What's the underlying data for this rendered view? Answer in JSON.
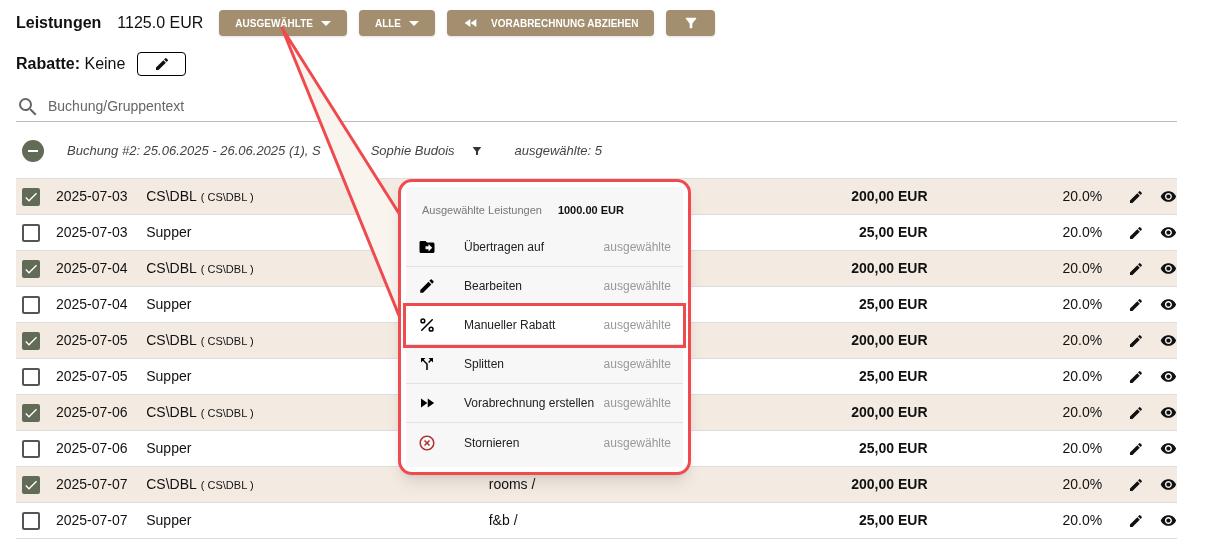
{
  "header": {
    "title": "Leistungen",
    "total": "1125.0 EUR"
  },
  "toolbar": [
    {
      "label": "AUSGEWÄHLTE",
      "kind": "dropdown"
    },
    {
      "label": "ALLE",
      "kind": "dropdown"
    },
    {
      "label": "VORABRECHNUNG ABZIEHEN",
      "kind": "rewind"
    },
    {
      "kind": "filter"
    }
  ],
  "discount": {
    "label": "Rabatte:",
    "value": "Keine"
  },
  "search": {
    "placeholder": "Buchung/Gruppentext"
  },
  "group": {
    "expanded": true,
    "title_start": "Buchung #2: 25.06.2025 - 26.06.2025 (1), S",
    "title_end": "Sophie Budois",
    "selected_count": "ausgewählte: 5"
  },
  "rows": [
    {
      "checked": true,
      "date": "2025-07-03",
      "name": "CS\\DBL",
      "code": "( CS\\DBL )",
      "amount": "200,00 EUR",
      "tax": "20.0%"
    },
    {
      "checked": false,
      "date": "2025-07-03",
      "name": "Supper",
      "amount": "25,00 EUR",
      "tax": "20.0%"
    },
    {
      "checked": true,
      "date": "2025-07-04",
      "name": "CS\\DBL",
      "code": "( CS\\DBL )",
      "amount": "200,00 EUR",
      "tax": "20.0%"
    },
    {
      "checked": false,
      "date": "2025-07-04",
      "name": "Supper",
      "amount": "25,00 EUR",
      "tax": "20.0%"
    },
    {
      "checked": true,
      "date": "2025-07-05",
      "name": "CS\\DBL",
      "code": "( CS\\DBL )",
      "amount": "200,00 EUR",
      "tax": "20.0%"
    },
    {
      "checked": false,
      "date": "2025-07-05",
      "name": "Supper",
      "amount": "25,00 EUR",
      "tax": "20.0%"
    },
    {
      "checked": true,
      "date": "2025-07-06",
      "name": "CS\\DBL",
      "code": "( CS\\DBL )",
      "amount": "200,00 EUR",
      "tax": "20.0%"
    },
    {
      "checked": false,
      "date": "2025-07-06",
      "name": "Supper",
      "amount": "25,00 EUR",
      "tax": "20.0%"
    },
    {
      "checked": true,
      "date": "2025-07-07",
      "name": "CS\\DBL",
      "code": "( CS\\DBL )",
      "column_3": "rooms /",
      "amount": "200,00 EUR",
      "tax": "20.0%"
    },
    {
      "checked": false,
      "date": "2025-07-07",
      "name": "Supper",
      "column_3": "f&b /",
      "amount": "25,00 EUR",
      "tax": "20.0%"
    }
  ],
  "menu": {
    "title": "Ausgewählte Leistungen",
    "total": "1000.00 EUR",
    "items": [
      {
        "label": "Übertragen auf",
        "scope": "ausgewählte",
        "selected": false
      },
      {
        "label": "Bearbeiten",
        "scope": "ausgewählte",
        "selected": false
      },
      {
        "label": "Manueller Rabatt",
        "scope": "ausgewählte",
        "selected": true
      },
      {
        "label": "Splitten",
        "scope": "ausgewählte",
        "selected": false
      },
      {
        "label": "Vorabrechnung erstellen",
        "scope": "ausgewählte",
        "selected": false
      },
      {
        "label": "Stornieren",
        "scope": "ausgewählte",
        "selected": false
      }
    ]
  }
}
